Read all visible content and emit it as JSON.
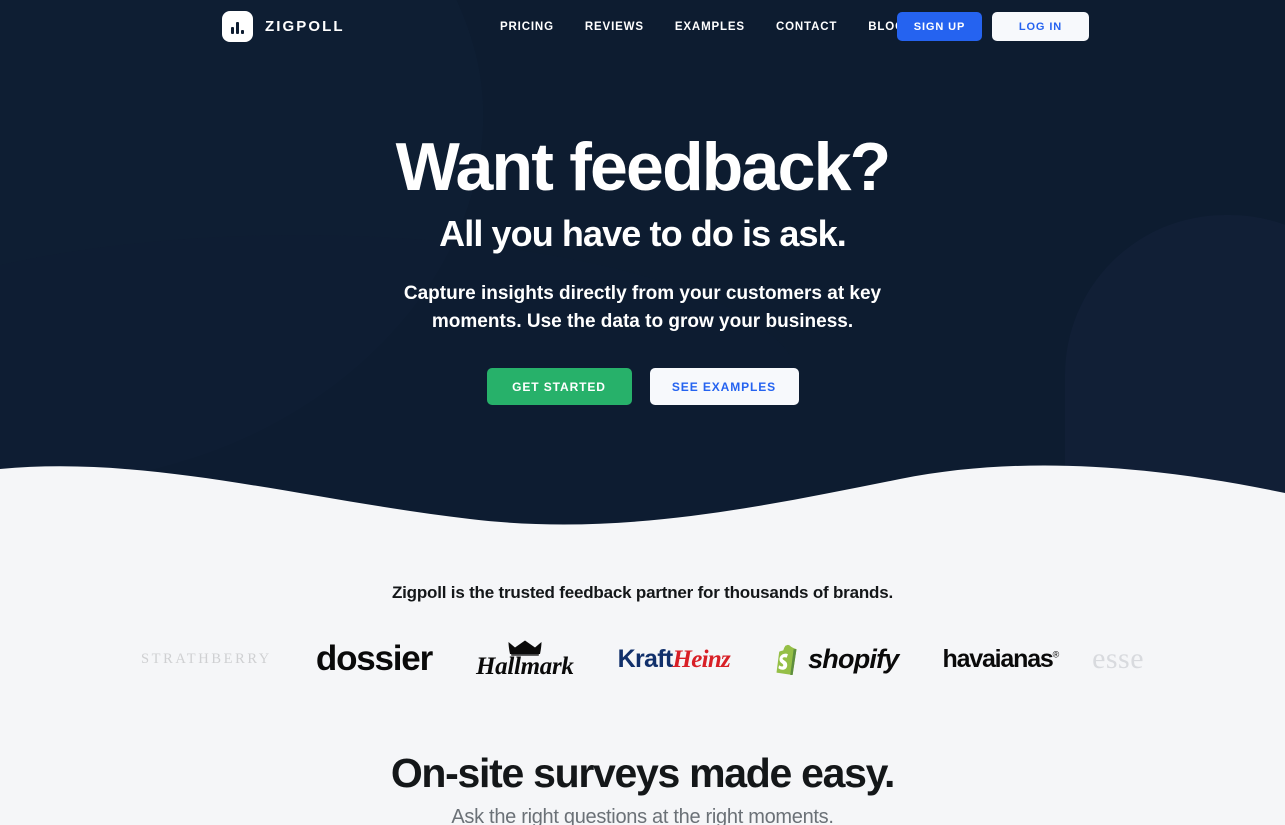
{
  "brand": {
    "name": "ZIGPOLL",
    "logo_icon": "bar-chart-logo-icon"
  },
  "nav": {
    "links": [
      {
        "label": "PRICING"
      },
      {
        "label": "REVIEWS"
      },
      {
        "label": "EXAMPLES"
      },
      {
        "label": "CONTACT"
      },
      {
        "label": "BLOG"
      }
    ],
    "signup_label": "SIGN UP",
    "login_label": "LOG IN"
  },
  "hero": {
    "title": "Want feedback?",
    "subtitle": "All you have to do is ask.",
    "description": "Capture insights directly from your customers at key moments. Use the data to grow your business.",
    "primary_cta": "GET STARTED",
    "secondary_cta": "SEE EXAMPLES"
  },
  "social_proof": {
    "heading": "Zigpoll is the trusted feedback partner for thousands of brands.",
    "brands": [
      {
        "name": "STRATHBERRY"
      },
      {
        "name": "dossier"
      },
      {
        "name": "Hallmark"
      },
      {
        "name": "Kraft",
        "name2": "Heinz"
      },
      {
        "name": "shopify"
      },
      {
        "name": "havaianas",
        "mark": "®"
      },
      {
        "name": "esse"
      }
    ]
  },
  "features": {
    "title": "On-site surveys made easy.",
    "subtitle": "Ask the right questions at the right moments."
  },
  "colors": {
    "hero_bg": "#0d1c30",
    "light_bg": "#f5f6f8",
    "accent_blue": "#2563f0",
    "accent_green": "#27b16a",
    "text_dark": "#141719",
    "text_muted": "#6b7177"
  }
}
